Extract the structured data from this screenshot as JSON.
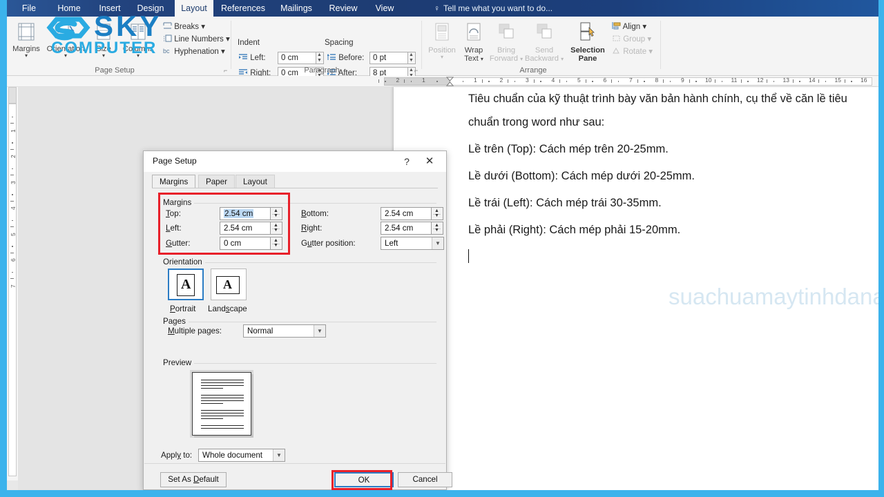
{
  "app": {
    "frame_color": "#3cb3ec",
    "tabs": [
      {
        "label": "File",
        "selected": false
      },
      {
        "label": "Home",
        "selected": false
      },
      {
        "label": "Insert",
        "selected": false
      },
      {
        "label": "Design",
        "selected": false
      },
      {
        "label": "Layout",
        "selected": true
      },
      {
        "label": "References",
        "selected": false
      },
      {
        "label": "Mailings",
        "selected": false
      },
      {
        "label": "Review",
        "selected": false
      },
      {
        "label": "View",
        "selected": false
      }
    ],
    "tell_me": "Tell me what you want to do..."
  },
  "ribbon": {
    "groups": [
      {
        "name": "Page Setup"
      },
      {
        "name": "Paragraph"
      },
      {
        "name": "Arrange"
      }
    ],
    "page_setup": {
      "big_buttons": [
        {
          "label1": "Margins",
          "label2": ""
        },
        {
          "label1": "Orientation",
          "label2": ""
        },
        {
          "label1": "Size",
          "label2": ""
        },
        {
          "label1": "Columns",
          "label2": ""
        }
      ],
      "small_buttons": [
        {
          "label": "Breaks"
        },
        {
          "label": "Line Numbers"
        },
        {
          "label": "Hyphenation"
        }
      ]
    },
    "paragraph": {
      "indent_header": "Indent",
      "spacing_header": "Spacing",
      "fields": [
        {
          "label": "Left:",
          "value": "0 cm"
        },
        {
          "label": "Right:",
          "value": "0 cm"
        },
        {
          "label": "Before:",
          "value": "0 pt"
        },
        {
          "label": "After:",
          "value": "8 pt"
        }
      ]
    },
    "arrange": {
      "big_buttons": [
        {
          "label1": "Position",
          "label2": "",
          "dim": false
        },
        {
          "label1": "Wrap",
          "label2": "Text",
          "dim": false
        },
        {
          "label1": "Bring",
          "label2": "Forward",
          "dim": true
        },
        {
          "label1": "Send",
          "label2": "Backward",
          "dim": true
        },
        {
          "label1": "Selection",
          "label2": "Pane",
          "dim": false
        }
      ],
      "small_buttons": [
        {
          "label": "Align",
          "dim": false
        },
        {
          "label": "Group",
          "dim": true
        },
        {
          "label": "Rotate",
          "dim": true
        }
      ]
    }
  },
  "ruler": {
    "horizontal_left": [
      "2",
      "1"
    ],
    "horizontal_right": [
      "1",
      "2",
      "3",
      "4",
      "5",
      "6",
      "7",
      "8",
      "9",
      "10",
      "11",
      "12",
      "13",
      "14",
      "15",
      "16"
    ],
    "vertical": [
      "1",
      "2",
      "3",
      "4",
      "5",
      "6",
      "7"
    ]
  },
  "document": {
    "watermark": "suachuamaytinhdanang.com",
    "paragraphs": [
      "Tiêu chuẩn của kỹ thuật trình bày văn bản hành chính, cụ thể về căn lề tiêu",
      "chuẩn trong word như sau:",
      "Lề trên (Top): Cách mép trên 20-25mm.",
      "Lề dưới (Bottom): Cách mép dưới 20-25mm.",
      "Lề trái (Left): Cách mép trái 30-35mm.",
      "Lề phải (Right): Cách mép phải 15-20mm."
    ]
  },
  "logo": {
    "line1": "SKY",
    "line2": "COMPUTER"
  },
  "dialog": {
    "title": "Page Setup",
    "help_glyph": "?",
    "close_glyph": "✕",
    "tabs": [
      {
        "label": "Margins",
        "selected": true
      },
      {
        "label": "Paper",
        "selected": false
      },
      {
        "label": "Layout",
        "selected": false
      }
    ],
    "margins": {
      "group_title": "Margins",
      "top": {
        "label": "Top:",
        "value": "2.54 cm",
        "selected": true
      },
      "left": {
        "label": "Left:",
        "value": "2.54 cm",
        "selected": false
      },
      "gutter": {
        "label": "Gutter:",
        "value": "0 cm",
        "selected": false
      },
      "bottom": {
        "label": "Bottom:",
        "value": "2.54 cm"
      },
      "right": {
        "label": "Right:",
        "value": "2.54 cm"
      },
      "gutter_position": {
        "label": "Gutter position:",
        "value": "Left"
      }
    },
    "orientation": {
      "group_title": "Orientation",
      "portrait": {
        "label": "Portrait",
        "selected": true,
        "glyph": "A"
      },
      "landscape": {
        "label": "Landscape",
        "selected": false,
        "glyph": "A"
      }
    },
    "pages": {
      "group_title": "Pages",
      "multiple_pages": {
        "label": "Multiple pages:",
        "value": "Normal"
      }
    },
    "preview": {
      "group_title": "Preview",
      "apply_to": {
        "label": "Apply to:",
        "value": "Whole document"
      }
    },
    "buttons": {
      "set_as_default": "Set As Default",
      "ok": "OK",
      "cancel": "Cancel"
    },
    "highlight_color": "#e8202a"
  }
}
